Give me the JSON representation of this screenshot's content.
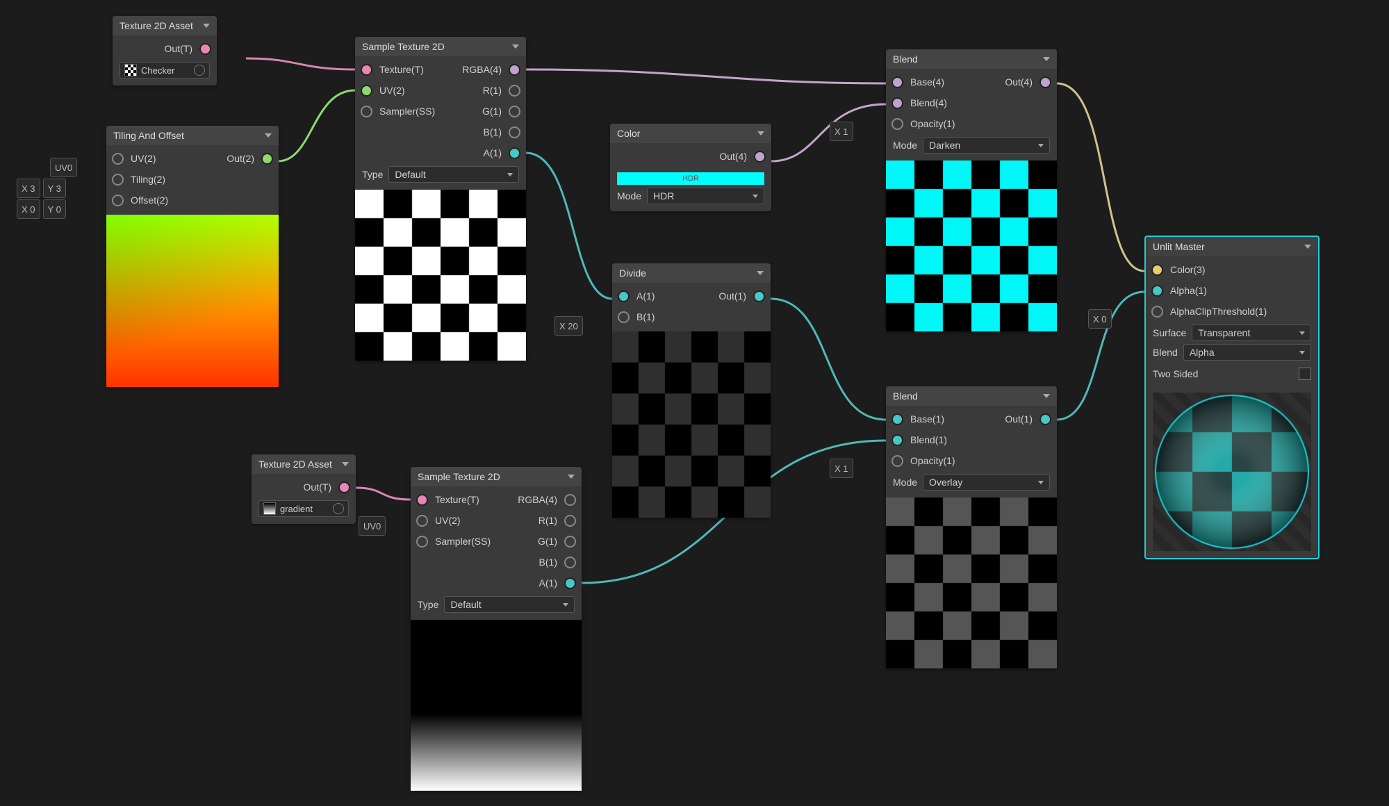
{
  "nodes": {
    "texAsset1": {
      "title": "Texture 2D Asset",
      "out": "Out(T)",
      "asset": "Checker"
    },
    "texAsset2": {
      "title": "Texture 2D Asset",
      "out": "Out(T)",
      "asset": "gradient"
    },
    "tiling": {
      "title": "Tiling And Offset",
      "in_uv": "UV(2)",
      "in_tiling": "Tiling(2)",
      "in_offset": "Offset(2)",
      "out": "Out(2)",
      "uvDrop": "UV0",
      "tilingX": "X 3",
      "tilingY": "Y 3",
      "offsetX": "X 0",
      "offsetY": "Y 0"
    },
    "sample1": {
      "title": "Sample Texture 2D",
      "in_tex": "Texture(T)",
      "in_uv": "UV(2)",
      "in_samp": "Sampler(SS)",
      "out_rgba": "RGBA(4)",
      "out_r": "R(1)",
      "out_g": "G(1)",
      "out_b": "B(1)",
      "out_a": "A(1)",
      "typeLabel": "Type",
      "typeVal": "Default"
    },
    "sample2": {
      "title": "Sample Texture 2D",
      "in_tex": "Texture(T)",
      "in_uv": "UV(2)",
      "in_samp": "Sampler(SS)",
      "out_rgba": "RGBA(4)",
      "out_r": "R(1)",
      "out_g": "G(1)",
      "out_b": "B(1)",
      "out_a": "A(1)",
      "typeLabel": "Type",
      "typeVal": "Default",
      "uvDrop": "UV0"
    },
    "color": {
      "title": "Color",
      "out": "Out(4)",
      "swatchText": "HDR",
      "modeLabel": "Mode",
      "modeVal": "HDR"
    },
    "divide": {
      "title": "Divide",
      "in_a": "A(1)",
      "in_b": "B(1)",
      "out": "Out(1)",
      "bField": "X 20"
    },
    "blend1": {
      "title": "Blend",
      "in_base": "Base(4)",
      "in_blend": "Blend(4)",
      "in_opac": "Opacity(1)",
      "out": "Out(4)",
      "opacField": "X 1",
      "modeLabel": "Mode",
      "modeVal": "Darken"
    },
    "blend2": {
      "title": "Blend",
      "in_base": "Base(1)",
      "in_blend": "Blend(1)",
      "in_opac": "Opacity(1)",
      "out": "Out(1)",
      "opacField": "X 1",
      "modeLabel": "Mode",
      "modeVal": "Overlay"
    },
    "master": {
      "title": "Unlit Master",
      "in_color": "Color(3)",
      "in_alpha": "Alpha(1)",
      "in_clip": "AlphaClipThreshold(1)",
      "clipField": "X 0",
      "surfaceLabel": "Surface",
      "surfaceVal": "Transparent",
      "blendLabel": "Blend",
      "blendVal": "Alpha",
      "twoSidedLabel": "Two Sided"
    }
  }
}
